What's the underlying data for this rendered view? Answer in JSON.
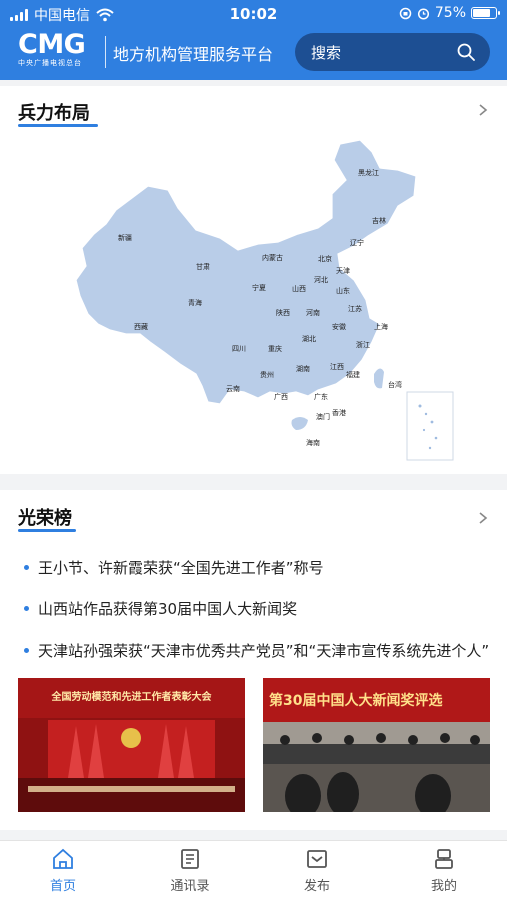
{
  "status_bar": {
    "carrier": "中国电信",
    "time": "10:02",
    "battery": "75%",
    "battery_level": 0.75
  },
  "header": {
    "logo_text": "CMG",
    "logo_subtitle": "中央广播电视总台",
    "platform_title": "地方机构管理服务平台",
    "search_placeholder": "搜索"
  },
  "deployment": {
    "title": "兵力布局",
    "map_labels": [
      "黑龙江",
      "吉林",
      "新疆",
      "辽宁",
      "内蒙古",
      "北京",
      "天津",
      "甘肃",
      "河北",
      "宁夏",
      "山西",
      "山东",
      "青海",
      "陕西",
      "河南",
      "江苏",
      "西藏",
      "安徽",
      "上海",
      "湖北",
      "四川",
      "重庆",
      "浙江",
      "江西",
      "湖南",
      "贵州",
      "福建",
      "云南",
      "台湾",
      "广西",
      "广东",
      "澳门",
      "香港",
      "海南"
    ]
  },
  "honors": {
    "title": "光荣榜",
    "items": [
      "王小节、许新霞荣获“全国先进工作者”称号",
      "山西站作品获得第30届中国人大新闻奖",
      "天津站孙强荣获“天津市优秀共产党员”和“天津市宣传系统先进个人”"
    ],
    "photo1_caption": "全国劳动模范和先进工作者表彰大会",
    "photo2_caption": "第30届中国人大新闻奖评选"
  },
  "tabs": [
    {
      "label": "首页",
      "icon": "home-icon"
    },
    {
      "label": "通讯录",
      "icon": "contacts-icon"
    },
    {
      "label": "发布",
      "icon": "publish-icon"
    },
    {
      "label": "我的",
      "icon": "profile-icon"
    }
  ],
  "colors": {
    "brand_blue": "#2f7fe0",
    "search_bg": "#1d4f93",
    "map_fill": "#b9cde8"
  }
}
